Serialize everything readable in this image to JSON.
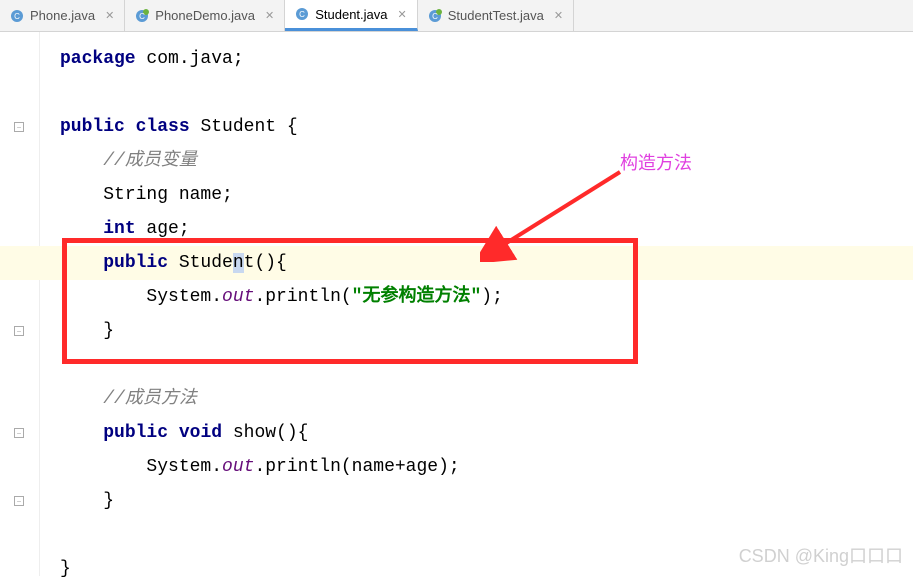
{
  "tabs": [
    {
      "label": "Phone.java",
      "active": false
    },
    {
      "label": "PhoneDemo.java",
      "active": false
    },
    {
      "label": "Student.java",
      "active": true
    },
    {
      "label": "StudentTest.java",
      "active": false
    }
  ],
  "annotation": {
    "text": "构造方法"
  },
  "watermark": {
    "text": "CSDN @King口口口"
  },
  "code": {
    "l1_kw1": "package",
    "l1_rest": " com.java;",
    "l2": "",
    "l3_kw1": "public",
    "l3_kw2": "class",
    "l3_rest": " Student {",
    "l4_indent": "    ",
    "l4_cm": "//成员变量",
    "l5_indent": "    ",
    "l5_t1": "String name;",
    "l6_indent": "    ",
    "l6_kw": "int",
    "l6_rest": " age;",
    "l7_indent": "    ",
    "l7_kw": "public",
    "l7_p1": " Stude",
    "l7_cursor": "n",
    "l7_p2": "t(){",
    "l8_indent": "        ",
    "l8_t1": "System.",
    "l8_fld": "out",
    "l8_t2": ".println(",
    "l8_str": "\"无参构造方法\"",
    "l8_t3": ");",
    "l9_indent": "    ",
    "l9_t": "}",
    "l10": "",
    "l11_indent": "    ",
    "l11_cm": "//成员方法",
    "l12_indent": "    ",
    "l12_kw1": "public",
    "l12_kw2": "void",
    "l12_rest": " show(){",
    "l13_indent": "        ",
    "l13_t1": "System.",
    "l13_fld": "out",
    "l13_t2": ".println(name+age);",
    "l14_indent": "    ",
    "l14_t": "}",
    "l15": "",
    "l16_t": "}"
  }
}
